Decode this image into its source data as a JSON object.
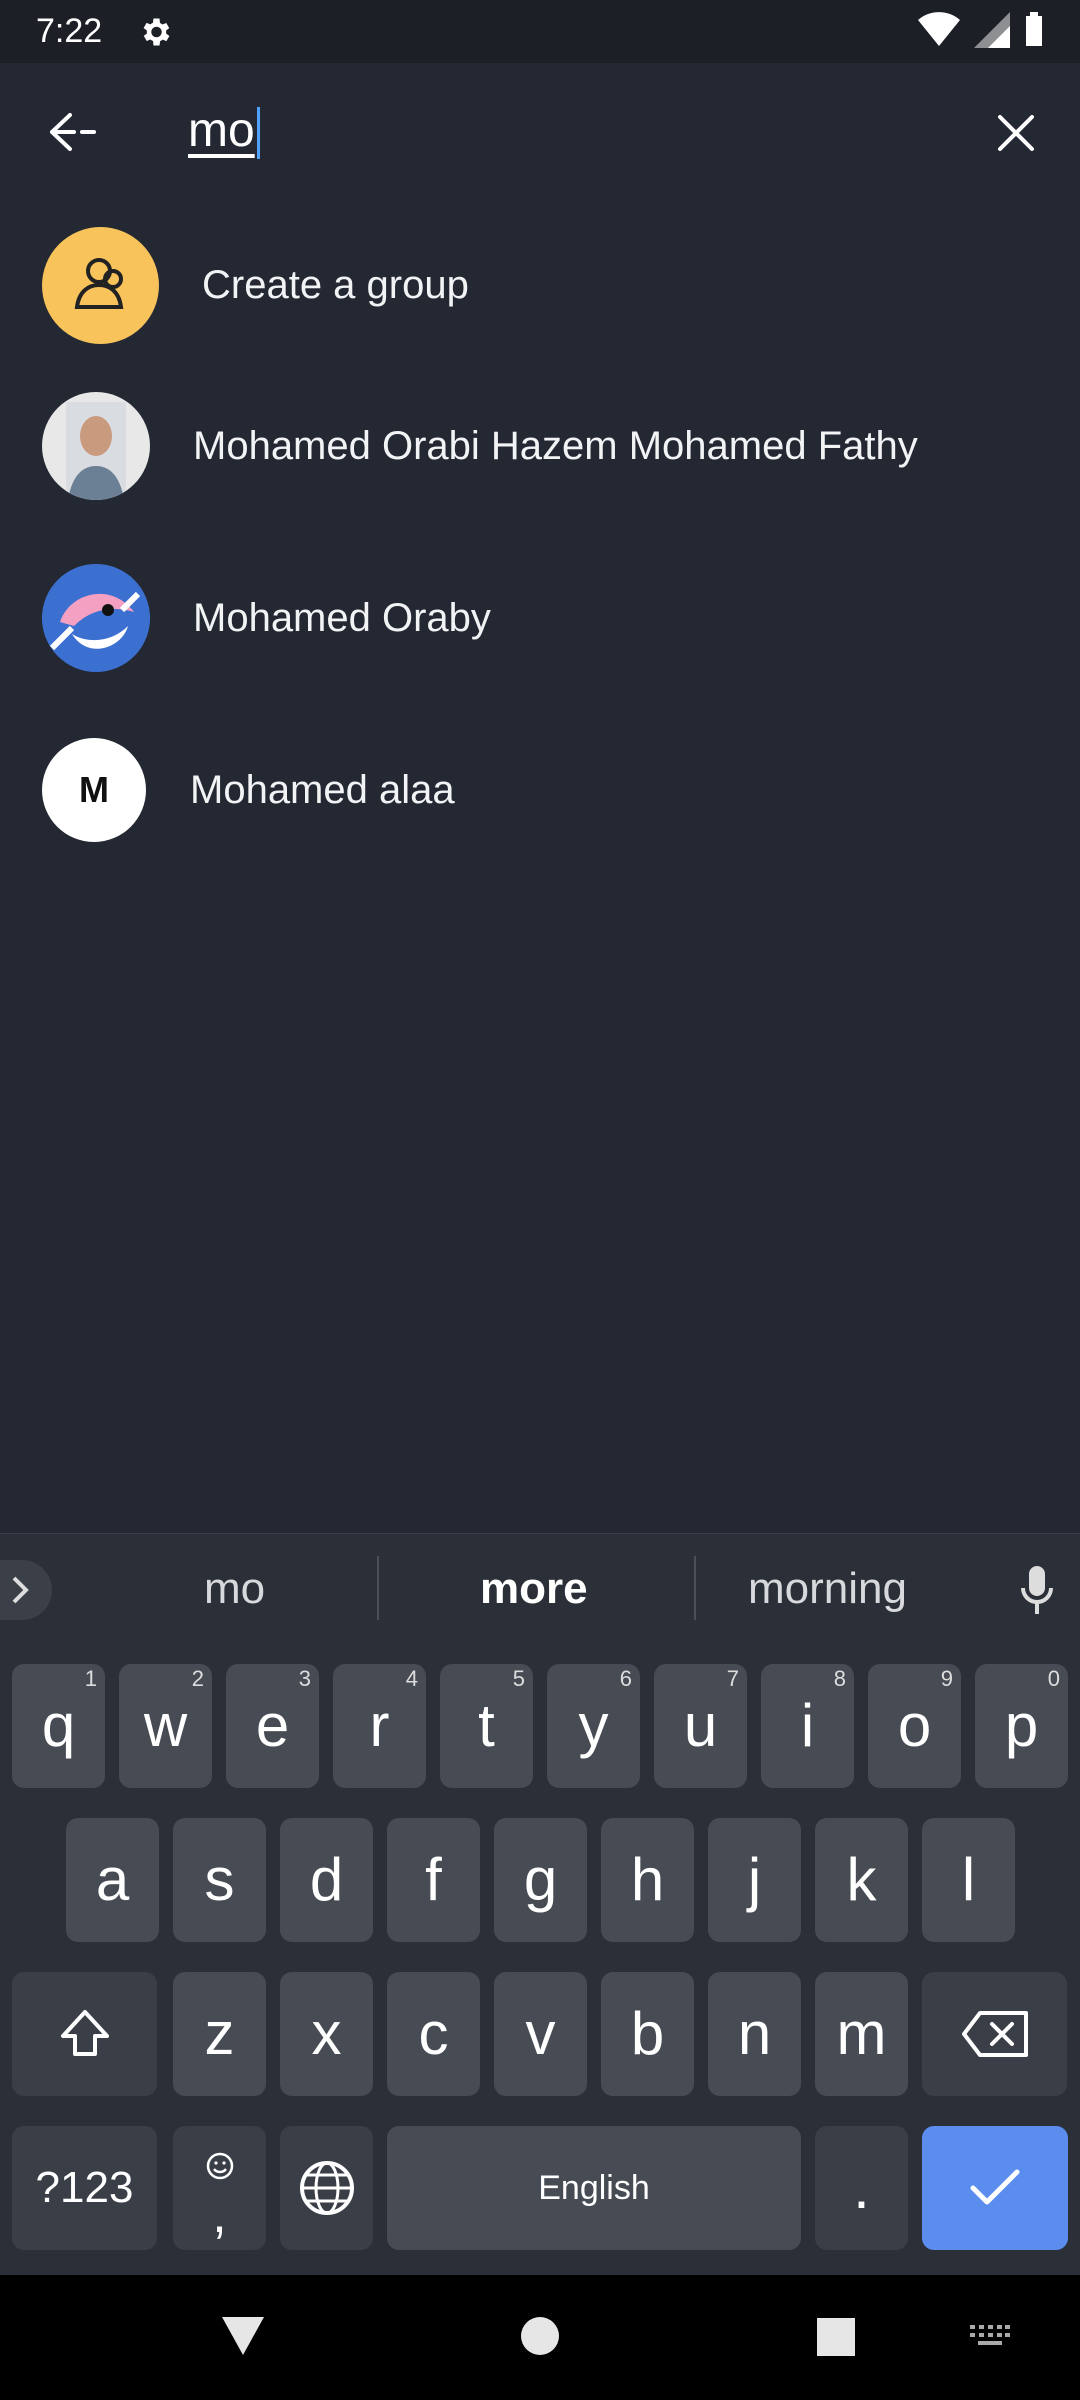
{
  "status_bar": {
    "time": "7:22"
  },
  "app_bar": {
    "search_text": "mo"
  },
  "results": [
    {
      "label": "Create a group"
    },
    {
      "label": "Mohamed Orabi Hazem Mohamed Fathy"
    },
    {
      "label": "Mohamed Oraby"
    },
    {
      "label": "Mohamed alaa",
      "avatar_letter": "M"
    }
  ],
  "keyboard": {
    "suggestions": [
      "mo",
      "more",
      "morning"
    ],
    "row1": [
      "q",
      "w",
      "e",
      "r",
      "t",
      "y",
      "u",
      "i",
      "o",
      "p"
    ],
    "row1_nums": [
      "1",
      "2",
      "3",
      "4",
      "5",
      "6",
      "7",
      "8",
      "9",
      "0"
    ],
    "row2": [
      "a",
      "s",
      "d",
      "f",
      "g",
      "h",
      "j",
      "k",
      "l"
    ],
    "row3": [
      "z",
      "x",
      "c",
      "v",
      "b",
      "n",
      "m"
    ],
    "symbols_label": "?123",
    "comma_label": ",",
    "space_label": "English",
    "period_label": "."
  },
  "colors": {
    "accent": "#5b8def",
    "group_avatar": "#f7c35a",
    "background": "#242833"
  }
}
